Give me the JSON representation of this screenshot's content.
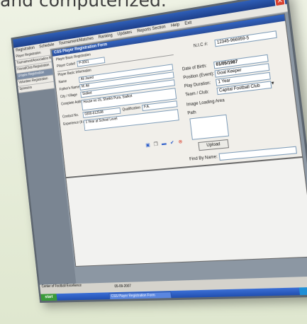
{
  "headline": "and computerized.",
  "window": {
    "close_glyph": "✕"
  },
  "menubar": [
    "Registration",
    "Schedule",
    "Tournament/Matches",
    "Ranking",
    "Updates",
    "Reports Section",
    "Help",
    "Exit"
  ],
  "sidebar": {
    "items": [
      {
        "label": "Player Registration",
        "selected": false
      },
      {
        "label": "Tournament/Association Registration",
        "selected": false
      },
      {
        "label": "Friend/Club Registration",
        "selected": false
      },
      {
        "label": "Umpire Registration",
        "selected": true
      },
      {
        "label": "Volunteer Registration",
        "selected": false
      },
      {
        "label": "Sponsors",
        "selected": false
      }
    ]
  },
  "form": {
    "title": "CSS Player Registration Form",
    "section_basic": "Player Basic Registration",
    "player_code_label": "Player Code#",
    "player_code_value": "P-0001",
    "section_basic_info": "Player Basic Information",
    "name_label": "Name",
    "name_value": "Ali Javed",
    "father_label": "Father's Name",
    "father_value": "M. Ali",
    "city_label": "City / Village",
    "city_value": "Sialkot",
    "address_label": "Complete Address",
    "address_value": "House no 15, Sheikh Pura, Sialkot",
    "contact_label": "Contact No.",
    "contact_value": "0300-612538",
    "qualification_label": "Qualification",
    "qualification_value": "F.A.",
    "experience_label": "Experience (if any)",
    "experience_value": "1 Year at School Level"
  },
  "right_panel": {
    "nic_label": "N.I.C #:",
    "nic_value": "12345-966959-5",
    "dob_label": "Date of Birth:",
    "dob_value": "01/05/1987",
    "position_label": "Position (Event):",
    "position_value": "Goal Keeper",
    "duration_label": "Play Duration:",
    "duration_value": "1 Year",
    "team_label": "Team / Club:",
    "team_value": "Capital Football Club",
    "image_area_label": "Image Loading Area",
    "path_label": "Path",
    "upload_label": "Upload",
    "find_label": "Find By Name:",
    "find_value": ""
  },
  "toolbar_icons": [
    "save-icon",
    "new-icon",
    "delete-icon",
    "confirm-icon",
    "cancel-icon"
  ],
  "status": {
    "line1": "Center of Football Excellence",
    "date": "05-09-2007"
  },
  "taskbar": {
    "start_label": "start",
    "items": [
      "CSS Player Registration Form"
    ]
  },
  "colors": {
    "title_blue": "#2a4e9a",
    "close_red": "#d8412f",
    "selected_item": "#7d8ea6"
  }
}
